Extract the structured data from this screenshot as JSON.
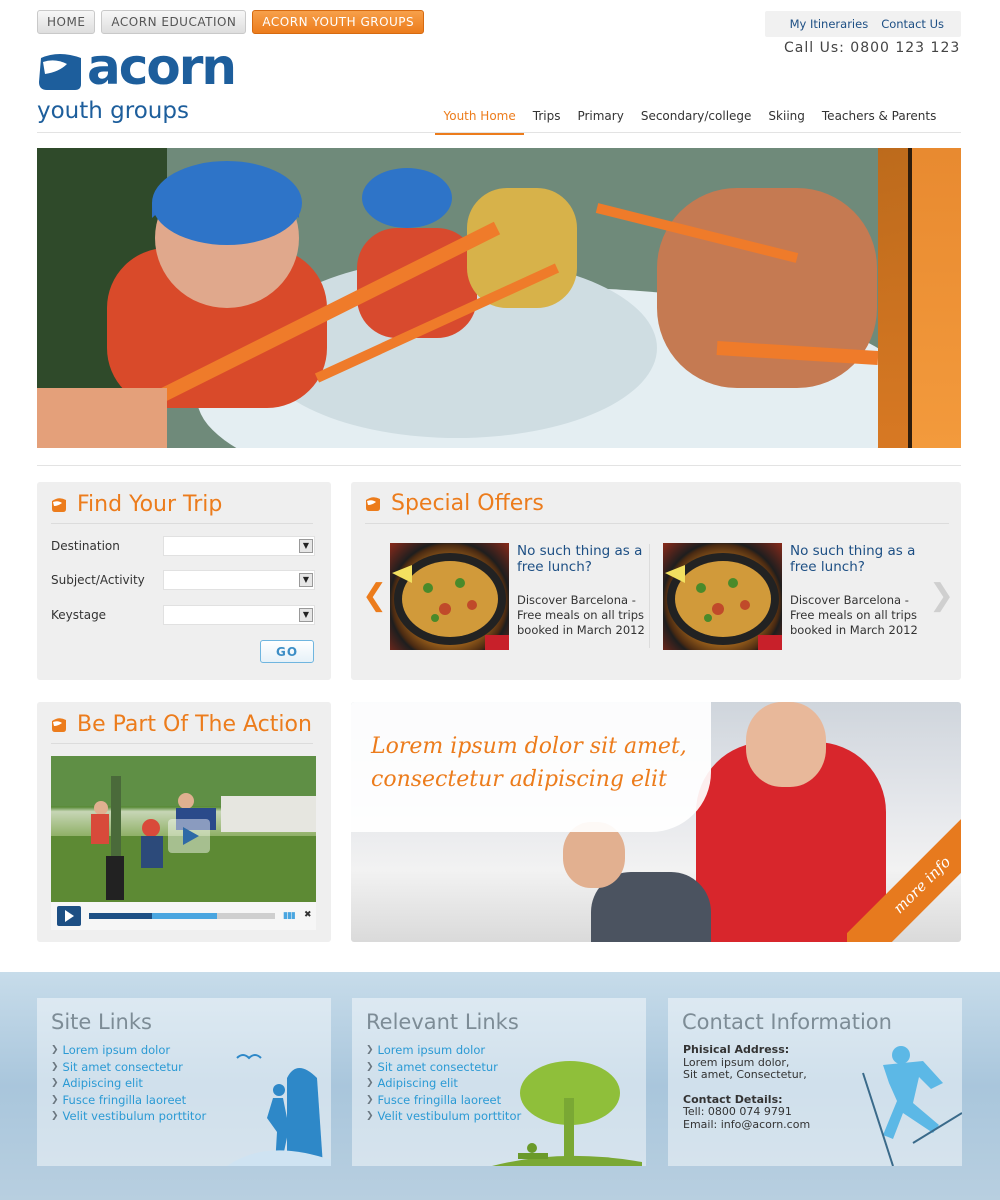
{
  "top_tabs": [
    "HOME",
    "ACORN EDUCATION",
    "ACORN YOUTH GROUPS"
  ],
  "utility": {
    "itineraries": "My Itineraries",
    "contact": "Contact Us",
    "phone": "Call Us: 0800 123 123"
  },
  "logo": {
    "word": "acorn",
    "sub": "youth groups"
  },
  "nav": [
    "Youth Home",
    "Trips",
    "Primary",
    "Secondary/college",
    "Skiing",
    "Teachers & Parents"
  ],
  "find_trip": {
    "title": "Find Your Trip",
    "fields": [
      "Destination",
      "Subject/Activity",
      "Keystage"
    ],
    "go": "GO"
  },
  "special_offers": {
    "title": "Special Offers",
    "items": [
      {
        "title": "No such thing as a free lunch?",
        "desc": "Discover Barcelona - Free meals on all trips booked in March 2012"
      },
      {
        "title": "No such thing as a free lunch?",
        "desc": "Discover Barcelona - Free meals on all trips booked in March 2012"
      }
    ]
  },
  "action": {
    "title": "Be Part Of The Action",
    "video_progress": 0.69,
    "video_buffered": 0.34
  },
  "promo": {
    "text": "Lorem ipsum dolor sit amet, consectetur adipiscing elit",
    "more_info": "more info"
  },
  "footer": {
    "site_links": {
      "title": "Site Links",
      "items": [
        "Lorem ipsum dolor",
        "Sit amet consectetur",
        "Adipiscing elit",
        "Fusce fringilla laoreet",
        "Velit vestibulum porttitor"
      ]
    },
    "relevant_links": {
      "title": "Relevant Links",
      "items": [
        "Lorem ipsum dolor",
        "Sit amet consectetur",
        "Adipiscing elit",
        "Fusce fringilla laoreet",
        "Velit vestibulum porttitor"
      ]
    },
    "contact": {
      "title": "Contact Information",
      "address_head": "Phisical Address:",
      "address_1": "Lorem ipsum dolor,",
      "address_2": "Sit amet, Consectetur,",
      "details_head": "Contact Details:",
      "tel": "Tell: 0800 074 9791",
      "email": "Email: info@acorn.com"
    }
  },
  "colors": {
    "accent": "#ec7c1c",
    "brand": "#1d5e9c",
    "link": "#2b9ad4"
  }
}
